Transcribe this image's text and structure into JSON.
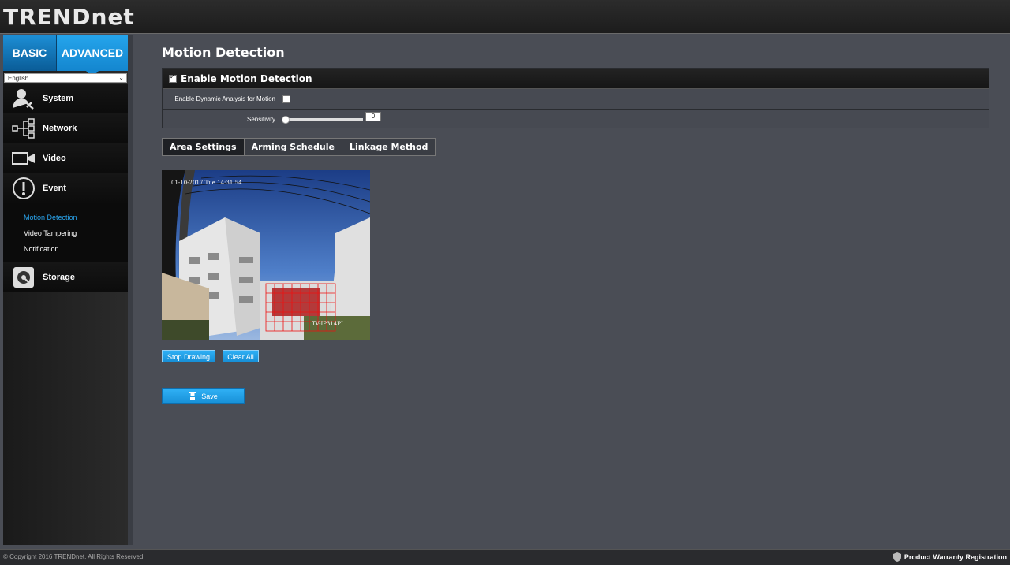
{
  "brand": {
    "logo_text": "TRENDnet"
  },
  "sidebar": {
    "tabs": {
      "basic": "BASIC",
      "advanced": "ADVANCED"
    },
    "language": "English",
    "items": [
      {
        "label": "System",
        "icon": "system-user-icon"
      },
      {
        "label": "Network",
        "icon": "network-icon"
      },
      {
        "label": "Video",
        "icon": "video-camera-icon"
      },
      {
        "label": "Event",
        "icon": "exclamation-icon"
      }
    ],
    "event_submenu": [
      "Motion Detection",
      "Video Tampering",
      "Notification"
    ],
    "storage": {
      "label": "Storage",
      "icon": "storage-icon"
    }
  },
  "page": {
    "title": "Motion Detection",
    "enable_label": "Enable Motion Detection",
    "dynamic_analysis_label": "Enable Dynamic Analysis for Motion",
    "sensitivity_label": "Sensitivity",
    "sensitivity_value": "0"
  },
  "subtabs": [
    "Area Settings",
    "Arming Schedule",
    "Linkage Method"
  ],
  "camera": {
    "timestamp": "01-10-2017 Tue 14:31:54",
    "cam_name": "TV-IP314PI"
  },
  "buttons": {
    "stop_drawing": "Stop Drawing",
    "clear_all": "Clear All",
    "save": "Save"
  },
  "footer": {
    "copyright": "© Copyright 2016 TRENDnet. All Rights Reserved.",
    "warranty": "Product Warranty Registration"
  },
  "colors": {
    "accent": "#1f9be3",
    "active_submenu": "#2aa6f0"
  }
}
